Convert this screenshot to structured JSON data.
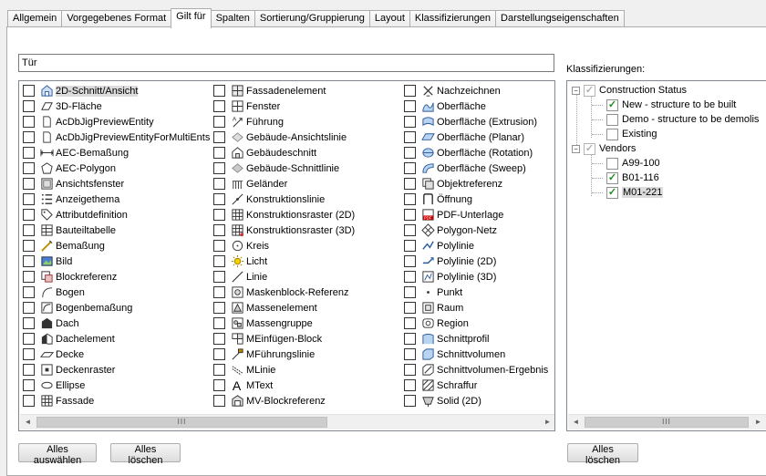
{
  "tabs": [
    {
      "label": "Allgemein"
    },
    {
      "label": "Vorgegebenes Format"
    },
    {
      "label": "Gilt für",
      "active": true
    },
    {
      "label": "Spalten"
    },
    {
      "label": "Sortierung/Gruppierung"
    },
    {
      "label": "Layout"
    },
    {
      "label": "Klassifizierungen"
    },
    {
      "label": "Darstellungseigenschaften"
    }
  ],
  "filter": {
    "value": "Tür"
  },
  "objects": {
    "columns": [
      [
        {
          "label": "2D-Schnitt/Ansicht",
          "icon": "section-view-icon",
          "selected": true
        },
        {
          "label": "3D-Fläche",
          "icon": "3d-face-icon"
        },
        {
          "label": "AcDbJigPreviewEntity",
          "icon": "document-icon"
        },
        {
          "label": "AcDbJigPreviewEntityForMultiEnts",
          "icon": "document-icon"
        },
        {
          "label": "AEC-Bemaßung",
          "icon": "aec-dimension-icon"
        },
        {
          "label": "AEC-Polygon",
          "icon": "polygon-icon"
        },
        {
          "label": "Ansichtsfenster",
          "icon": "viewport-icon"
        },
        {
          "label": "Anzeigethema",
          "icon": "display-theme-icon"
        },
        {
          "label": "Attributdefinition",
          "icon": "tag-icon"
        },
        {
          "label": "Bauteiltabelle",
          "icon": "table-icon"
        },
        {
          "label": "Bemaßung",
          "icon": "dimension-icon"
        },
        {
          "label": "Bild",
          "icon": "image-icon"
        },
        {
          "label": "Blockreferenz",
          "icon": "block-reference-icon"
        },
        {
          "label": "Bogen",
          "icon": "arc-icon"
        },
        {
          "label": "Bogenbemaßung",
          "icon": "arc-dimension-icon"
        },
        {
          "label": "Dach",
          "icon": "roof-icon"
        },
        {
          "label": "Dachelement",
          "icon": "roof-element-icon"
        },
        {
          "label": "Decke",
          "icon": "slab-icon"
        },
        {
          "label": "Deckenraster",
          "icon": "ceiling-grid-icon"
        },
        {
          "label": "Ellipse",
          "icon": "ellipse-icon"
        },
        {
          "label": "Fassade",
          "icon": "grid-icon"
        }
      ],
      [
        {
          "label": "Fassadenelement",
          "icon": "curtain-wall-unit-icon"
        },
        {
          "label": "Fenster",
          "icon": "window-icon"
        },
        {
          "label": "Führung",
          "icon": "leader-icon"
        },
        {
          "label": "Gebäude-Ansichtslinie",
          "icon": "building-elevation-line-icon"
        },
        {
          "label": "Gebäudeschnitt",
          "icon": "building-section-icon"
        },
        {
          "label": "Gebäude-Schnittlinie",
          "icon": "building-section-line-icon"
        },
        {
          "label": "Geländer",
          "icon": "railing-icon"
        },
        {
          "label": "Konstruktionslinie",
          "icon": "construction-line-icon"
        },
        {
          "label": "Konstruktionsraster (2D)",
          "icon": "grid-icon"
        },
        {
          "label": "Konstruktionsraster (3D)",
          "icon": "grid-3d-icon"
        },
        {
          "label": "Kreis",
          "icon": "circle-icon"
        },
        {
          "label": "Licht",
          "icon": "light-icon"
        },
        {
          "label": "Linie",
          "icon": "line-icon"
        },
        {
          "label": "Maskenblock-Referenz",
          "icon": "mask-block-icon"
        },
        {
          "label": "Massenelement",
          "icon": "mass-element-icon"
        },
        {
          "label": "Massengruppe",
          "icon": "mass-group-icon"
        },
        {
          "label": "MEinfügen-Block",
          "icon": "minsert-block-icon"
        },
        {
          "label": "MFührungslinie",
          "icon": "mleader-icon"
        },
        {
          "label": "MLinie",
          "icon": "mline-icon"
        },
        {
          "label": "MText",
          "icon": "mtext-icon"
        },
        {
          "label": "MV-Blockreferenz",
          "icon": "mv-block-icon"
        }
      ],
      [
        {
          "label": "Nachzeichnen",
          "icon": "trace-icon"
        },
        {
          "label": "Oberfläche",
          "icon": "surface-icon"
        },
        {
          "label": "Oberfläche (Extrusion)",
          "icon": "surface-extrusion-icon"
        },
        {
          "label": "Oberfläche (Planar)",
          "icon": "surface-planar-icon"
        },
        {
          "label": "Oberfläche (Rotation)",
          "icon": "surface-rotation-icon"
        },
        {
          "label": "Oberfläche (Sweep)",
          "icon": "surface-sweep-icon"
        },
        {
          "label": "Objektreferenz",
          "icon": "object-reference-icon"
        },
        {
          "label": "Öffnung",
          "icon": "opening-icon"
        },
        {
          "label": "PDF-Unterlage",
          "icon": "pdf-icon"
        },
        {
          "label": "Polygon-Netz",
          "icon": "polygon-mesh-icon"
        },
        {
          "label": "Polylinie",
          "icon": "polyline-icon"
        },
        {
          "label": "Polylinie (2D)",
          "icon": "polyline-2d-icon"
        },
        {
          "label": "Polylinie (3D)",
          "icon": "polyline-3d-icon"
        },
        {
          "label": "Punkt",
          "icon": "point-icon"
        },
        {
          "label": "Raum",
          "icon": "space-icon"
        },
        {
          "label": "Region",
          "icon": "region-icon"
        },
        {
          "label": "Schnittprofil",
          "icon": "section-profile-icon"
        },
        {
          "label": "Schnittvolumen",
          "icon": "section-volume-icon"
        },
        {
          "label": "Schnittvolumen-Ergebnis",
          "icon": "section-volume-result-icon"
        },
        {
          "label": "Schraffur",
          "icon": "hatch-icon"
        },
        {
          "label": "Solid (2D)",
          "icon": "solid-2d-icon"
        }
      ]
    ]
  },
  "buttons": {
    "select_all": "Alles auswählen",
    "clear_all": "Alles löschen",
    "clear_all_right": "Alles löschen"
  },
  "scroll_glyphs": {
    "left": "◄",
    "right": "►",
    "thumb": "III"
  },
  "classifications": {
    "label": "Klassifizierungen:",
    "tree": [
      {
        "label": "Construction Status",
        "level": 0,
        "expander": "−",
        "check": "✓",
        "state": "grey"
      },
      {
        "label": "New - structure to be built",
        "level": 1,
        "check": "✓",
        "state": "checked"
      },
      {
        "label": "Demo - structure to be demolis",
        "level": 1,
        "check": "",
        "state": "unchecked"
      },
      {
        "label": "Existing",
        "level": 1,
        "check": "",
        "state": "unchecked"
      },
      {
        "label": "Vendors",
        "level": 0,
        "expander": "−",
        "check": "✓",
        "state": "grey"
      },
      {
        "label": "A99-100",
        "level": 1,
        "check": "",
        "state": "unchecked"
      },
      {
        "label": "B01-116",
        "level": 1,
        "check": "✓",
        "state": "checked"
      },
      {
        "label": "M01-221",
        "level": 1,
        "check": "✓",
        "state": "checked",
        "selected": true
      }
    ]
  }
}
